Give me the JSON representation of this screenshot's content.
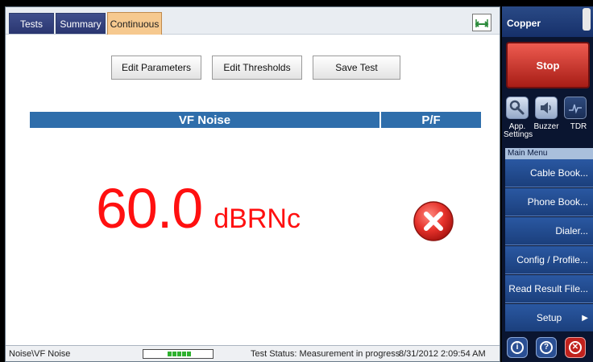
{
  "tabs": [
    {
      "label": "Tests",
      "active": false
    },
    {
      "label": "Summary",
      "active": false
    },
    {
      "label": "Continuous",
      "active": true
    }
  ],
  "actions": {
    "edit_parameters": "Edit Parameters",
    "edit_thresholds": "Edit Thresholds",
    "save_test": "Save Test"
  },
  "result": {
    "header_measurement": "VF Noise",
    "header_pf": "P/F",
    "value": "60.0",
    "unit": "dBRNc",
    "pass_fail": "fail",
    "value_color": "#ff1010"
  },
  "status_bar": {
    "path": "Noise\\VF Noise",
    "status": "Test Status: Measurement in progress",
    "datetime": "8/31/2012 2:09:54 AM"
  },
  "side_panel": {
    "title": "Copper",
    "stop_label": "Stop",
    "tools": [
      {
        "label": "App. Settings",
        "icon": "wrench-icon"
      },
      {
        "label": "Buzzer",
        "icon": "speaker-icon"
      },
      {
        "label": "TDR",
        "icon": "waveform-icon"
      }
    ],
    "main_menu_label": "Main Menu",
    "menu": [
      {
        "label": "Cable Book..."
      },
      {
        "label": "Phone Book..."
      },
      {
        "label": "Dialer..."
      },
      {
        "label": "Config / Profile..."
      },
      {
        "label": "Read Result File..."
      },
      {
        "label": "Setup"
      }
    ],
    "bottom_buttons": [
      {
        "icon": "info-icon",
        "glyph": "i"
      },
      {
        "icon": "help-icon",
        "glyph": "?"
      },
      {
        "icon": "exit-icon",
        "glyph": "✕"
      }
    ]
  },
  "colors": {
    "header_blue": "#2f6eab",
    "stop_red": "#c0221d",
    "tab_active": "#f6c98f",
    "menu_blue": "#1b3f7c"
  }
}
